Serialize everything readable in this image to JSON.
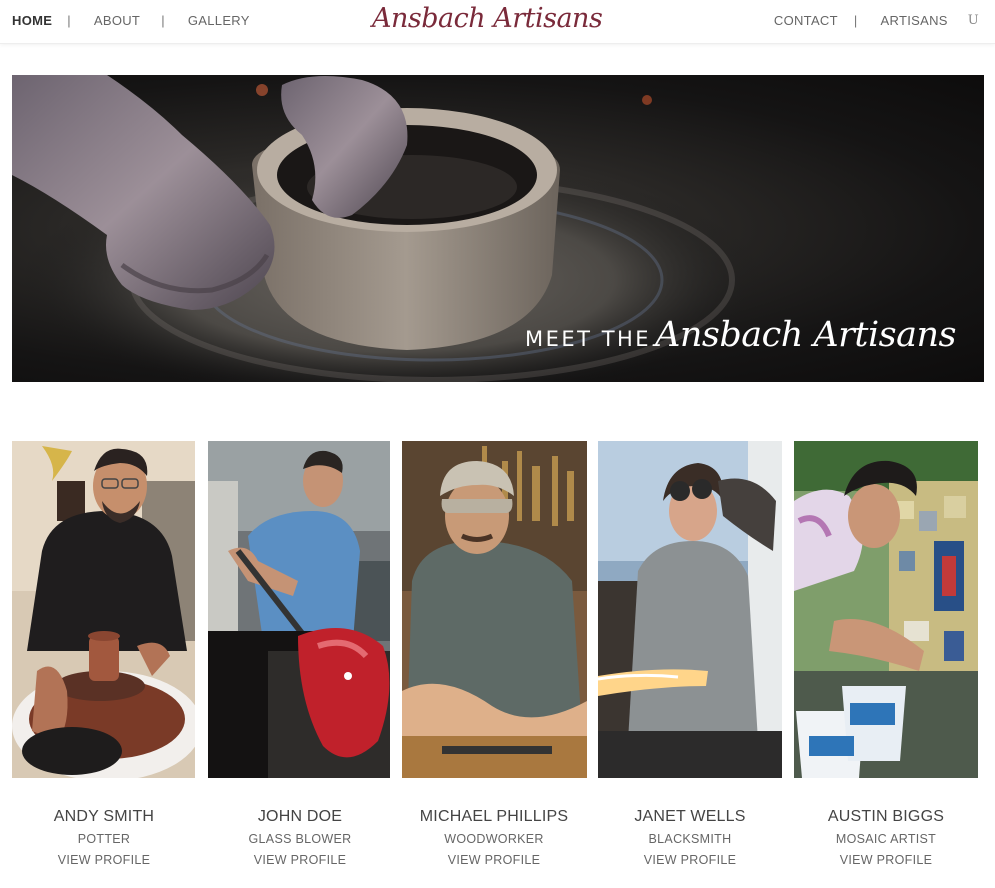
{
  "header": {
    "brand": "Ansbach Artisans",
    "nav_left": [
      {
        "label": "HOME"
      },
      {
        "label": "ABOUT"
      },
      {
        "label": "GALLERY"
      }
    ],
    "nav_right": [
      {
        "label": "CONTACT"
      },
      {
        "label": "ARTISANS"
      },
      {
        "label": "U"
      }
    ],
    "separator": "|"
  },
  "hero": {
    "caption_prefix": "MEET THE",
    "caption_name": "Ansbach Artisans"
  },
  "artisans": [
    {
      "name": "ANDY SMITH",
      "role": "POTTER",
      "link": "VIEW PROFILE"
    },
    {
      "name": "JOHN DOE",
      "role": "GLASS BLOWER",
      "link": "VIEW PROFILE"
    },
    {
      "name": "MICHAEL PHILLIPS",
      "role": "WOODWORKER",
      "link": "VIEW PROFILE"
    },
    {
      "name": "JANET WELLS",
      "role": "BLACKSMITH",
      "link": "VIEW PROFILE"
    },
    {
      "name": "AUSTIN BIGGS",
      "role": "MOSAIC ARTIST",
      "link": "VIEW PROFILE"
    }
  ]
}
